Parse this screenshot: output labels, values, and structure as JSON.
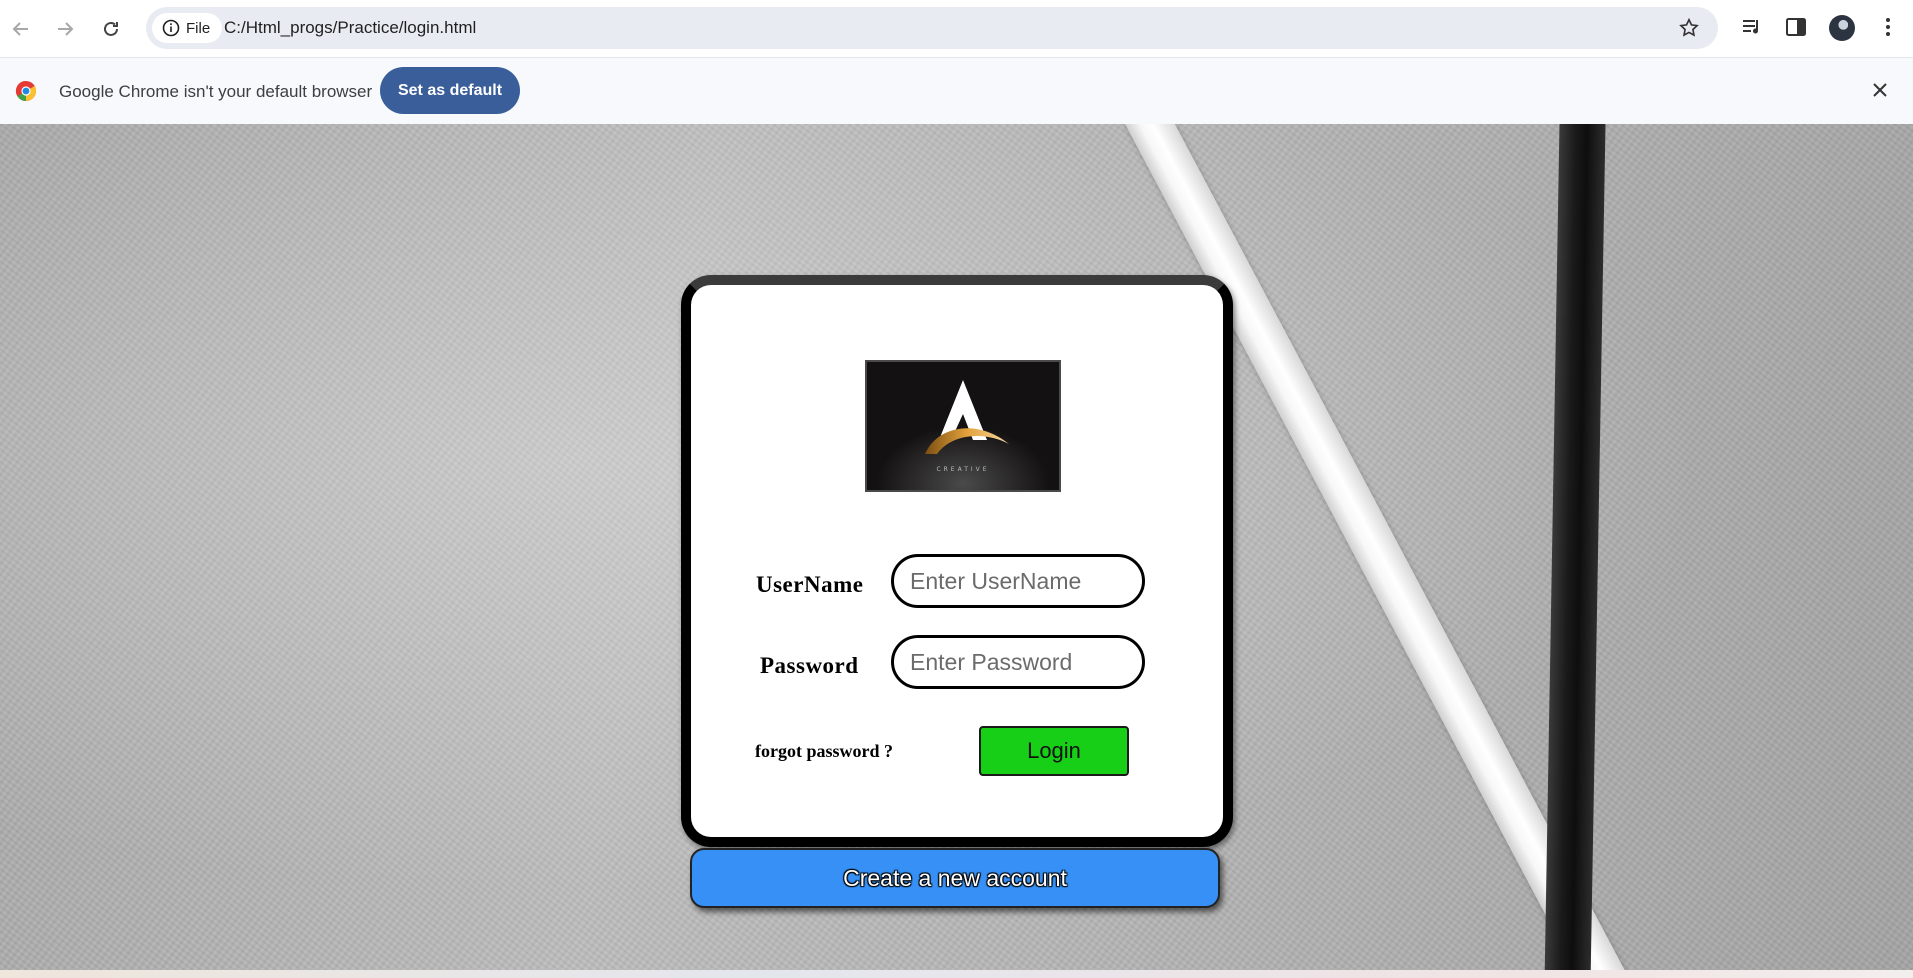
{
  "browser": {
    "chip_label": "File",
    "url": "C:/Html_progs/Practice/login.html"
  },
  "infobar": {
    "message": "Google Chrome isn't your default browser",
    "button_label": "Set as default"
  },
  "login": {
    "logo_text": "CREATIVE",
    "username_label": "UserName",
    "username_placeholder": "Enter UserName",
    "username_value": "",
    "password_label": "Password",
    "password_placeholder": "Enter Password",
    "password_value": "",
    "forgot_label": "forgot password ?",
    "login_label": "Login",
    "create_label": "Create a new account"
  },
  "colors": {
    "login_button": "#16cf16",
    "create_button": "#3690f5",
    "set_default_button": "#3a5e9a"
  }
}
